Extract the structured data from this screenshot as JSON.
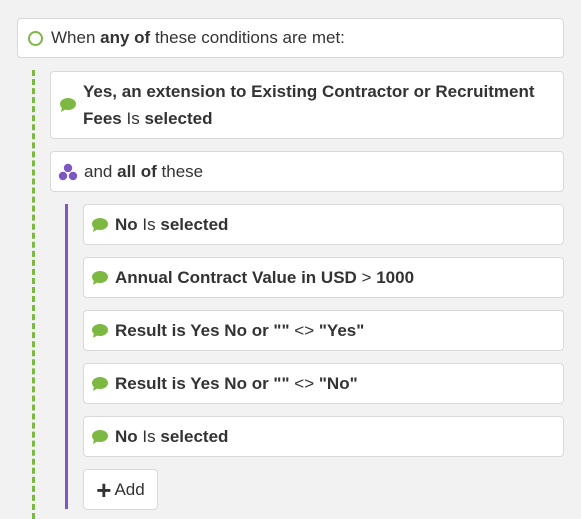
{
  "root": {
    "prefix": "When",
    "quantifier": "any of",
    "suffix": "these conditions are met:"
  },
  "conditions": [
    {
      "field": "Yes, an extension to Existing Contractor or Recruitment Fees",
      "operator": "Is",
      "value": "selected"
    }
  ],
  "group": {
    "prefix": "and",
    "quantifier": "all of",
    "suffix": "these",
    "conditions": [
      {
        "field": "No",
        "operator": "Is",
        "value": "selected"
      },
      {
        "field": "Annual Contract Value in USD",
        "operator": ">",
        "value": "1000"
      },
      {
        "field": "Result is Yes No or \"\"",
        "operator": "<>",
        "value": "\"Yes\""
      },
      {
        "field": "Result is Yes No or \"\"",
        "operator": "<>",
        "value": "\"No\""
      },
      {
        "field": "No",
        "operator": "Is",
        "value": "selected"
      }
    ]
  },
  "add_button": {
    "icon": "plus-icon",
    "label": "Add"
  },
  "colors": {
    "green": "#7db843",
    "purple": "#7e57c2"
  }
}
